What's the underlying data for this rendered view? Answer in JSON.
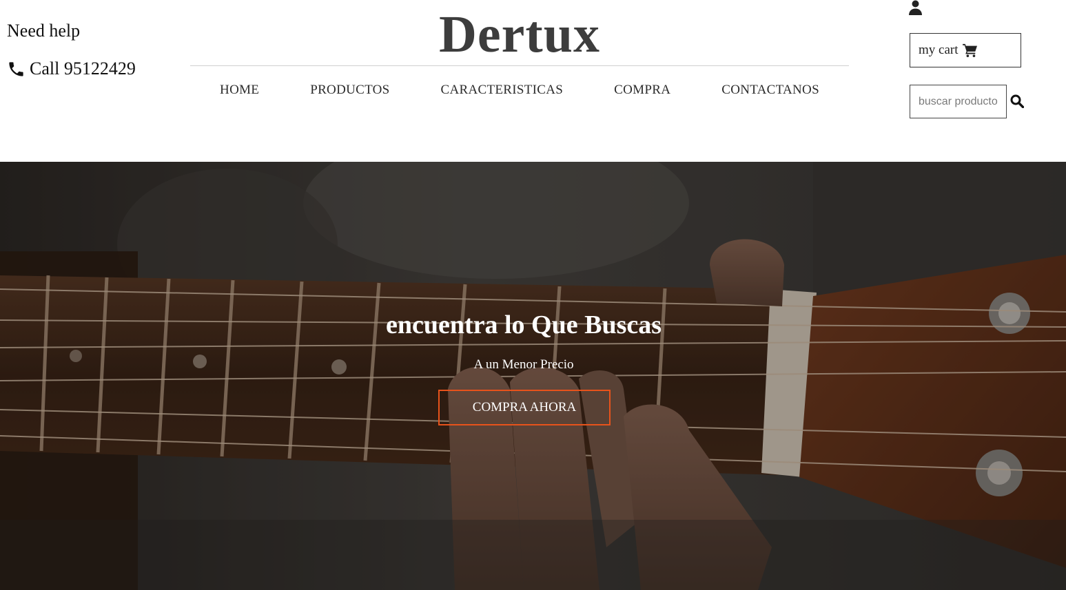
{
  "header": {
    "help_text": "Need help",
    "call_text": "Call 95122429",
    "logo": "Dertux",
    "nav": [
      {
        "label": "HOME"
      },
      {
        "label": "PRODUCTOS"
      },
      {
        "label": "CARACTERISTICAS"
      },
      {
        "label": "COMPRA"
      },
      {
        "label": "CONTACTANOS"
      }
    ],
    "cart_label": "my cart",
    "search_placeholder": "buscar producto",
    "icons": {
      "phone": "phone-icon",
      "user": "user-icon",
      "cart": "cart-icon",
      "search": "search-icon"
    }
  },
  "hero": {
    "title": "encuentra lo Que Buscas",
    "subtitle": "A un Menor Precio",
    "button_label": "COMPRA AHORA",
    "accent_color": "#e8531b"
  }
}
